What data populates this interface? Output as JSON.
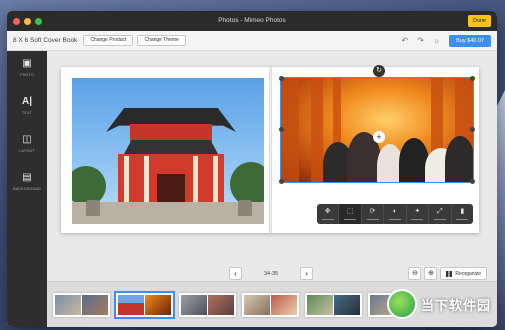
{
  "window": {
    "title": "Photos - Mimeo Photos",
    "done_label": "Done"
  },
  "toolbar": {
    "book_title": "8 X 6 Soft Cover Book",
    "change_product_label": "Change Product",
    "change_theme_label": "Change Theme",
    "undo_icon": "undo-icon",
    "redo_icon": "redo-icon",
    "tip_icon": "lightbulb-icon",
    "buy_label": "Buy $40.07"
  },
  "sidebar": {
    "items": [
      {
        "label": "PHOTO",
        "icon": "photo-icon"
      },
      {
        "label": "TEXT",
        "icon": "text-icon"
      },
      {
        "label": "LAYOUT",
        "icon": "layout-icon"
      },
      {
        "label": "BACKGROUND",
        "icon": "background-icon"
      }
    ]
  },
  "pager": {
    "prev_icon": "chevron-left-icon",
    "pages_label": "34-35",
    "next_icon": "chevron-right-icon"
  },
  "filmstrip_controls": {
    "reorganize_label": "Reorganize"
  },
  "watermark": {
    "text": "当下软件园"
  },
  "colors": {
    "accent": "#3d8ef0",
    "done": "#f5c518",
    "sidebar_bg": "#2e2e2e"
  }
}
